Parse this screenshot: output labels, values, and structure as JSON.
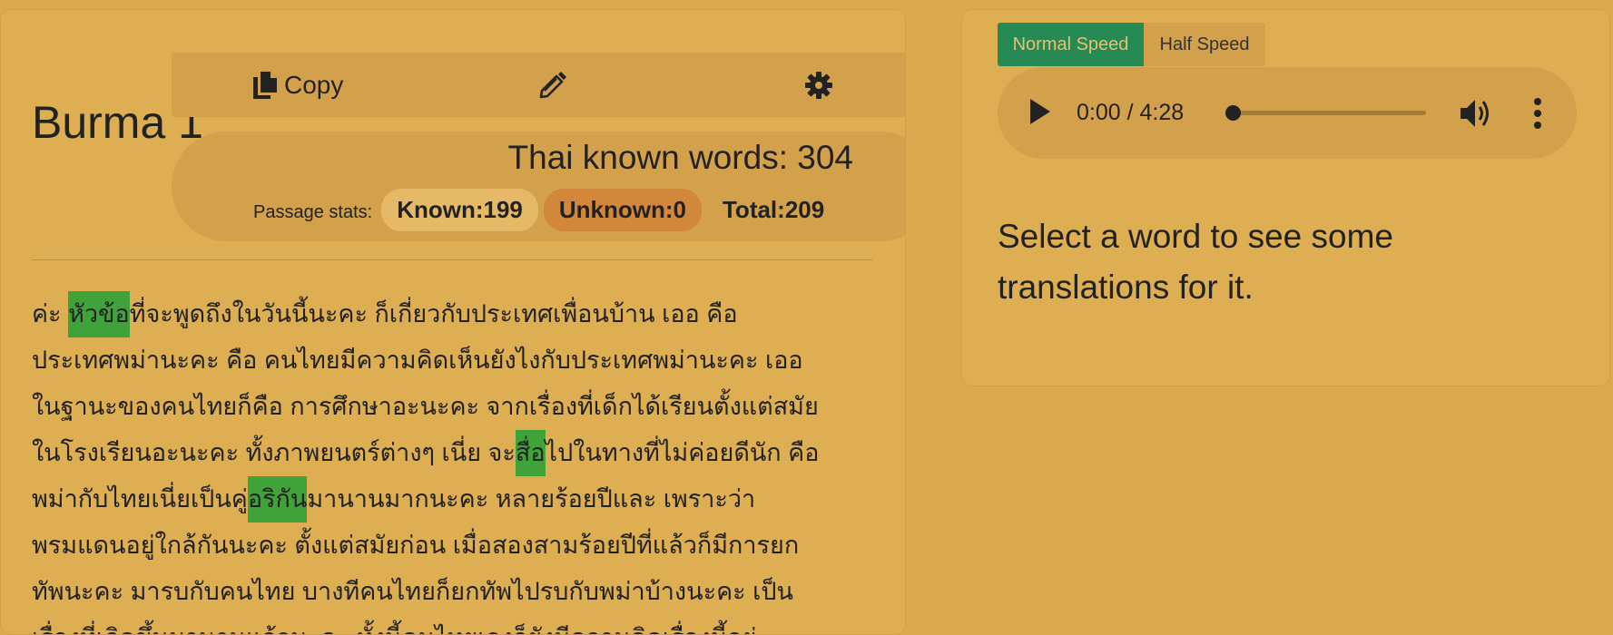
{
  "passage": {
    "title": "Burma 1",
    "known_words_label": "Thai known words: 304",
    "stats_label": "Passage stats:",
    "known_label": "Known:199",
    "unknown_label": "Unknown:0",
    "total_label": "Total:209",
    "lines": [
      [
        {
          "t": "ค่ะ "
        },
        {
          "t": "หัวข้อ",
          "hl": true
        },
        {
          "t": "ที่จะพูดถึงในวันนี้นะคะ ก็เกี่ยวกับประเทศเพื่อนบ้าน เออ คือ"
        }
      ],
      [
        {
          "t": "ประเทศพม่านะคะ คือ คนไทยมีความคิดเห็นยังไงกับประเทศพม่านะคะ เออ"
        }
      ],
      [
        {
          "t": "ในฐานะของคนไทยก็คือ การศึกษาอะนะคะ จากเรื่องที่เด็กได้เรียนตั้งแต่สมัย"
        }
      ],
      [
        {
          "t": "ในโรงเรียนอะนะคะ ทั้งภาพยนตร์ต่างๆ เนี่ย จะ"
        },
        {
          "t": "สื่อ",
          "hl": true
        },
        {
          "t": "ไปในทางที่ไม่ค่อยดีนัก คือ"
        }
      ],
      [
        {
          "t": "พม่ากับไทยเนี่ยเป็นคู่"
        },
        {
          "t": "อริกัน",
          "hl": true
        },
        {
          "t": "มานานมากนะคะ หลายร้อยปีและ เพราะว่า"
        }
      ],
      [
        {
          "t": "พรมแดนอยู่ใกล้กันนะคะ ตั้งแต่สมัยก่อน เมื่อสองสามร้อยปีที่แล้วก็มีการยก"
        }
      ],
      [
        {
          "t": "ทัพนะคะ มารบกับคนไทย บางทีคนไทยก็ยกทัพไปรบกับพม่าบ้างนะคะ เป็น"
        }
      ],
      [
        {
          "t": "เรื่องที่เกิดขึ้นมานานแล้วนะคะ ทั้งนี้คนไทยเองก็ยังมีความคิดเรื่องนี้อยู่"
        }
      ]
    ]
  },
  "toolbar": {
    "copy_label": "Copy",
    "copy_icon": "copy-icon",
    "edit_icon": "pencil-icon",
    "settings_icon": "gear-icon"
  },
  "player": {
    "normal_speed_label": "Normal Speed",
    "half_speed_label": "Half Speed",
    "selected_speed": "Normal Speed",
    "time_label": "0:00 / 4:28",
    "progress": 0,
    "play_icon": "play-icon",
    "volume_icon": "volume-icon",
    "more_icon": "more-vertical-icon"
  },
  "translation": {
    "hint": "Select a word to see some translations for it."
  },
  "colors": {
    "background": "#dba94e",
    "highlight": "#3fa339",
    "speed_active": "#268a55",
    "unknown_badge": "#d2873a"
  }
}
